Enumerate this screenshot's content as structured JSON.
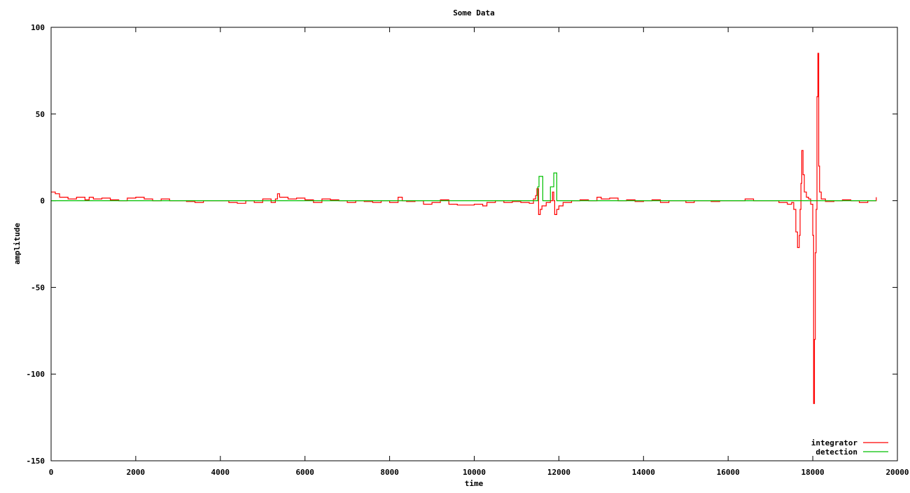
{
  "chart_data": {
    "type": "line",
    "title": "Some Data",
    "xlabel": "time",
    "ylabel": "amplitude",
    "xlim": [
      0,
      20000
    ],
    "ylim": [
      -150,
      100
    ],
    "xticks": [
      0,
      2000,
      4000,
      6000,
      8000,
      10000,
      12000,
      14000,
      16000,
      18000,
      20000
    ],
    "yticks": [
      -150,
      -100,
      -50,
      0,
      50,
      100
    ],
    "grid": false,
    "legend_position": "bottom-right",
    "series": [
      {
        "name": "integrator",
        "color": "#ff0000",
        "style": "steps",
        "points": [
          [
            0,
            5
          ],
          [
            100,
            4
          ],
          [
            200,
            2
          ],
          [
            400,
            1
          ],
          [
            600,
            2
          ],
          [
            800,
            0.5
          ],
          [
            900,
            2
          ],
          [
            1000,
            1
          ],
          [
            1200,
            1.5
          ],
          [
            1400,
            0.5
          ],
          [
            1600,
            0
          ],
          [
            1800,
            1.5
          ],
          [
            2000,
            2
          ],
          [
            2200,
            1
          ],
          [
            2400,
            0
          ],
          [
            2600,
            1
          ],
          [
            2800,
            0
          ],
          [
            3000,
            0
          ],
          [
            3200,
            -0.5
          ],
          [
            3400,
            -1
          ],
          [
            3600,
            0
          ],
          [
            3800,
            0
          ],
          [
            4000,
            0
          ],
          [
            4200,
            -1
          ],
          [
            4400,
            -1.5
          ],
          [
            4600,
            0
          ],
          [
            4800,
            -1
          ],
          [
            5000,
            1
          ],
          [
            5200,
            -1
          ],
          [
            5300,
            1
          ],
          [
            5350,
            4
          ],
          [
            5400,
            2
          ],
          [
            5600,
            1
          ],
          [
            5800,
            1.5
          ],
          [
            6000,
            0.5
          ],
          [
            6200,
            -1
          ],
          [
            6400,
            1
          ],
          [
            6600,
            0.5
          ],
          [
            6800,
            0
          ],
          [
            7000,
            -1
          ],
          [
            7200,
            0
          ],
          [
            7400,
            -0.5
          ],
          [
            7600,
            -1
          ],
          [
            7800,
            0
          ],
          [
            8000,
            -1
          ],
          [
            8200,
            2
          ],
          [
            8300,
            0
          ],
          [
            8400,
            -0.5
          ],
          [
            8600,
            0
          ],
          [
            8800,
            -2
          ],
          [
            9000,
            -1
          ],
          [
            9200,
            0.5
          ],
          [
            9400,
            -2
          ],
          [
            9600,
            -2.5
          ],
          [
            9800,
            -2.5
          ],
          [
            10000,
            -2
          ],
          [
            10200,
            -3
          ],
          [
            10300,
            -1
          ],
          [
            10500,
            0
          ],
          [
            10700,
            -1
          ],
          [
            10900,
            -0.5
          ],
          [
            11100,
            -1
          ],
          [
            11300,
            -1.5
          ],
          [
            11400,
            1
          ],
          [
            11450,
            3
          ],
          [
            11480,
            7
          ],
          [
            11520,
            -8
          ],
          [
            11560,
            -5
          ],
          [
            11600,
            -3
          ],
          [
            11700,
            -1
          ],
          [
            11800,
            0
          ],
          [
            11850,
            5
          ],
          [
            11880,
            0
          ],
          [
            11900,
            -8
          ],
          [
            11950,
            -5
          ],
          [
            12000,
            -3
          ],
          [
            12100,
            -1
          ],
          [
            12300,
            0
          ],
          [
            12500,
            0.5
          ],
          [
            12700,
            0
          ],
          [
            12900,
            2
          ],
          [
            13000,
            1
          ],
          [
            13200,
            1.5
          ],
          [
            13400,
            0
          ],
          [
            13600,
            0.5
          ],
          [
            13800,
            -0.5
          ],
          [
            14000,
            0
          ],
          [
            14200,
            0.5
          ],
          [
            14400,
            -1
          ],
          [
            14600,
            0
          ],
          [
            14800,
            0
          ],
          [
            15000,
            -1
          ],
          [
            15200,
            0
          ],
          [
            15400,
            0
          ],
          [
            15600,
            -0.5
          ],
          [
            15800,
            0
          ],
          [
            16000,
            0
          ],
          [
            16200,
            0
          ],
          [
            16400,
            1
          ],
          [
            16600,
            0
          ],
          [
            16800,
            0
          ],
          [
            17000,
            0
          ],
          [
            17200,
            -1
          ],
          [
            17400,
            -2
          ],
          [
            17500,
            -1
          ],
          [
            17550,
            -5
          ],
          [
            17600,
            -18
          ],
          [
            17640,
            -27
          ],
          [
            17680,
            -20
          ],
          [
            17700,
            -5
          ],
          [
            17720,
            10
          ],
          [
            17740,
            29
          ],
          [
            17770,
            15
          ],
          [
            17800,
            5
          ],
          [
            17850,
            2
          ],
          [
            17900,
            1
          ],
          [
            17950,
            -2
          ],
          [
            18000,
            -20
          ],
          [
            18020,
            -117
          ],
          [
            18040,
            -80
          ],
          [
            18060,
            -30
          ],
          [
            18080,
            -5
          ],
          [
            18100,
            60
          ],
          [
            18120,
            85
          ],
          [
            18140,
            20
          ],
          [
            18160,
            5
          ],
          [
            18200,
            1
          ],
          [
            18300,
            -0.5
          ],
          [
            18500,
            0
          ],
          [
            18700,
            0.5
          ],
          [
            18900,
            0
          ],
          [
            19100,
            -1
          ],
          [
            19300,
            0
          ],
          [
            19500,
            2
          ]
        ]
      },
      {
        "name": "detection",
        "color": "#00c000",
        "style": "steps",
        "points": [
          [
            0,
            0
          ],
          [
            11500,
            8
          ],
          [
            11530,
            14
          ],
          [
            11620,
            0
          ],
          [
            11800,
            8
          ],
          [
            11880,
            16
          ],
          [
            11950,
            0
          ],
          [
            19500,
            0
          ]
        ]
      }
    ]
  }
}
